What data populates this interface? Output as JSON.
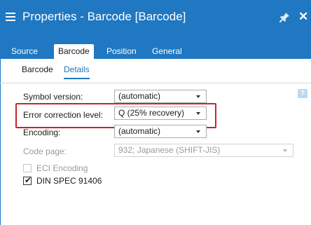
{
  "window": {
    "title": "Properties - Barcode [Barcode]",
    "icons": {
      "menu": "hamburger-menu-icon",
      "pin": "pin-icon",
      "close": "close-icon"
    }
  },
  "tabs": [
    {
      "label": "Source",
      "active": false
    },
    {
      "label": "Barcode",
      "active": true
    },
    {
      "label": "Position",
      "active": false
    },
    {
      "label": "General",
      "active": false
    }
  ],
  "subtabs": [
    {
      "label": "Barcode",
      "active": false
    },
    {
      "label": "Details",
      "active": true
    }
  ],
  "fields": {
    "symbol_version": {
      "label": "Symbol version:",
      "value": "(automatic)"
    },
    "error_correction": {
      "label": "Error correction level:",
      "value": "Q (25% recovery)"
    },
    "encoding": {
      "label": "Encoding:",
      "value": "(automatic)"
    },
    "code_page": {
      "label": "Code page:",
      "value": "932; Japanese (SHIFT-JIS)",
      "disabled": true
    }
  },
  "checkboxes": {
    "eci_encoding": {
      "label": "ECI Encoding",
      "checked": false,
      "disabled": true
    },
    "din_spec": {
      "label": "DIN SPEC 91406",
      "checked": true,
      "disabled": false
    }
  },
  "colors": {
    "accent": "#1f78c1",
    "highlight": "#c1272d"
  }
}
